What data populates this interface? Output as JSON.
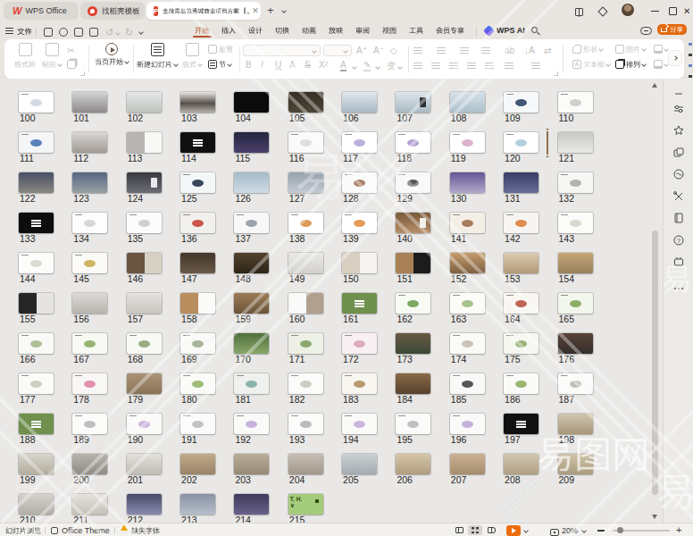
{
  "window": {
    "tabs": [
      {
        "label": "WPS Office",
        "icon": "wps-logo"
      },
      {
        "label": "找稻壳模板",
        "icon": "docer-logo"
      },
      {
        "label": "金茂青岛览秀城商业项目方案",
        "icon": "ppt-file-icon",
        "active": true
      }
    ],
    "new_tab": "+",
    "controls": [
      "split-view",
      "3d-cube",
      "avatar",
      "minimize",
      "maximize",
      "close"
    ]
  },
  "menubar": {
    "file_label": "文件",
    "quick_icons": [
      "save",
      "export-pdf",
      "print",
      "print-preview",
      "undo",
      "redo",
      "more"
    ],
    "items": [
      {
        "label": "开始",
        "active": true
      },
      {
        "label": "插入"
      },
      {
        "label": "设计"
      },
      {
        "label": "切换"
      },
      {
        "label": "动画"
      },
      {
        "label": "放映"
      },
      {
        "label": "审阅"
      },
      {
        "label": "视图"
      },
      {
        "label": "工具"
      },
      {
        "label": "会员专享"
      }
    ],
    "ai_label": "WPS AI",
    "share_label": "分享",
    "accent_color": "#b5532a",
    "share_color": "#e2690f"
  },
  "ribbon": {
    "format_painter": "格式刷",
    "paste": "粘贴",
    "play_current": "当页开始",
    "new_slide": "新建幻灯片",
    "layout": "版式",
    "reset": "重置",
    "section": "节",
    "font_toggles": [
      "B",
      "I",
      "U",
      "A",
      "S",
      "X²"
    ],
    "shapes": "形状",
    "picture": "图片",
    "textbox": "文本框",
    "arrange": "排列"
  },
  "sorter": {
    "slides": [
      {
        "n": "100",
        "t": "wh",
        "c": [
          "#ffffff"
        ],
        "a": "#ccd4de"
      },
      {
        "n": "101",
        "t": "ph",
        "c": [
          "#d2d1d3",
          "#8e898b"
        ]
      },
      {
        "n": "102",
        "t": "ph",
        "c": [
          "#e6e8e7",
          "#bcc2bd"
        ]
      },
      {
        "n": "103",
        "t": "phm",
        "c": [
          "#e9e7e3",
          "#57504c",
          "#b3afa9"
        ]
      },
      {
        "n": "104",
        "t": "bk",
        "c": [
          "#0b0b0b"
        ]
      },
      {
        "n": "105",
        "t": "ph",
        "c": [
          "#352f25",
          "#4d4737"
        ]
      },
      {
        "n": "106",
        "t": "ph",
        "c": [
          "#e2e8ec",
          "#a7b8c3"
        ]
      },
      {
        "n": "107",
        "t": "ph",
        "c": [
          "#dee6eb",
          "#a8b8c2"
        ],
        "a": "#2b2f34"
      },
      {
        "n": "108",
        "t": "ph",
        "c": [
          "#d7e2e9",
          "#abbfcb"
        ]
      },
      {
        "n": "109",
        "t": "wh",
        "c": [
          "#f6f8f9"
        ],
        "a": "#1e3a5e"
      },
      {
        "n": "110",
        "t": "wh",
        "c": [
          "#fbfbfa"
        ],
        "a": "#c7c7c4"
      },
      {
        "n": "111",
        "t": "wh",
        "c": [
          "#f3f5f7"
        ],
        "a": "#3f6cb0"
      },
      {
        "n": "112",
        "t": "ph",
        "c": [
          "#dad6d3",
          "#a09a95"
        ]
      },
      {
        "n": "113",
        "t": "spl",
        "c": [
          "#b7b4b1",
          "#f8f8f7"
        ]
      },
      {
        "n": "114",
        "t": "bk",
        "c": [
          "#101010"
        ],
        "i": 1
      },
      {
        "n": "115",
        "t": "ph",
        "c": [
          "#23263c",
          "#4b3f6d"
        ]
      },
      {
        "n": "116",
        "t": "wh",
        "c": [
          "#fafafa"
        ],
        "a": "#d8d8d8"
      },
      {
        "n": "117",
        "t": "wh",
        "c": [
          "#ffffff"
        ],
        "a": "#b2a1d5"
      },
      {
        "n": "118",
        "t": "wh",
        "c": [
          "#ffffff"
        ],
        "a": "#a78fcb"
      },
      {
        "n": "119",
        "t": "wh",
        "c": [
          "#ffffff"
        ],
        "a": "#d4a7c7"
      },
      {
        "n": "120",
        "t": "wh",
        "c": [
          "#ffffff"
        ],
        "a": "#a7c7d7"
      },
      {
        "n": "121",
        "t": "ph",
        "c": [
          "#c6c6c4",
          "#eaeae8"
        ]
      },
      {
        "n": "122",
        "t": "ph",
        "c": [
          "#475067",
          "#8c8780"
        ]
      },
      {
        "n": "123",
        "t": "ph",
        "c": [
          "#566681",
          "#99a0a4"
        ]
      },
      {
        "n": "124",
        "t": "ph",
        "c": [
          "#393940",
          "#6d6d75"
        ],
        "a": "#e8e8ed"
      },
      {
        "n": "125",
        "t": "wh",
        "c": [
          "#f4f7f8"
        ],
        "a": "#182840"
      },
      {
        "n": "126",
        "t": "ph",
        "c": [
          "#a5b9c8",
          "#cfdce5"
        ]
      },
      {
        "n": "127",
        "t": "ph",
        "c": [
          "#96a2ad",
          "#c3cbd3"
        ]
      },
      {
        "n": "128",
        "t": "wh",
        "c": [
          "#fafafa"
        ],
        "a": "#9f6950"
      },
      {
        "n": "129",
        "t": "wh",
        "c": [
          "#f8f8f8"
        ],
        "a": "#3a3a3a"
      },
      {
        "n": "130",
        "t": "ph",
        "c": [
          "#645593",
          "#b3a9cc"
        ]
      },
      {
        "n": "131",
        "t": "ph",
        "c": [
          "#373c65",
          "#696e99"
        ]
      },
      {
        "n": "132",
        "t": "wh",
        "c": [
          "#f6f6f5"
        ],
        "a": "#a7a7a3"
      },
      {
        "n": "133",
        "t": "bk",
        "c": [
          "#0d0d0d"
        ],
        "i": 1
      },
      {
        "n": "134",
        "t": "wh",
        "c": [
          "#fdfdfd"
        ],
        "a": "#cfcfcb"
      },
      {
        "n": "135",
        "t": "wh",
        "c": [
          "#fcfcfc"
        ],
        "a": "#c7c7c3"
      },
      {
        "n": "136",
        "t": "wh",
        "c": [
          "#f1f0ee"
        ],
        "a": "#c23a2e"
      },
      {
        "n": "137",
        "t": "wh",
        "c": [
          "#f8f8f8"
        ],
        "a": "#8995a1"
      },
      {
        "n": "138",
        "t": "wh",
        "c": [
          "#ffffff"
        ],
        "a": "#d78939"
      },
      {
        "n": "139",
        "t": "wh",
        "c": [
          "#ffffff"
        ],
        "a": "#df8939"
      },
      {
        "n": "140",
        "t": "ph",
        "c": [
          "#795a3a",
          "#b78f69"
        ],
        "a": "#f4f1e9"
      },
      {
        "n": "141",
        "t": "wh",
        "c": [
          "#f4efe6"
        ],
        "a": "#996944"
      },
      {
        "n": "142",
        "t": "wh",
        "c": [
          "#f7f5f1"
        ],
        "a": "#dc7930"
      },
      {
        "n": "143",
        "t": "wh",
        "c": [
          "#fbfbf9"
        ],
        "a": "#d4d1c7"
      },
      {
        "n": "144",
        "t": "wh",
        "c": [
          "#fcfcfb"
        ],
        "a": "#d7d4cb"
      },
      {
        "n": "145",
        "t": "wh",
        "c": [
          "#fbfaf7"
        ],
        "a": "#c7a749"
      },
      {
        "n": "146",
        "t": "spl",
        "c": [
          "#6a5543",
          "#d7d1c5"
        ]
      },
      {
        "n": "147",
        "t": "ph",
        "c": [
          "#42352a",
          "#6a5a48"
        ]
      },
      {
        "n": "148",
        "t": "ph",
        "c": [
          "#53422e",
          "#2e2518"
        ]
      },
      {
        "n": "149",
        "t": "ph",
        "c": [
          "#e9e8e5",
          "#d3d1cc"
        ]
      },
      {
        "n": "150",
        "t": "spl",
        "c": [
          "#d8cfc1",
          "#f5f4f1"
        ]
      },
      {
        "n": "151",
        "t": "spl",
        "c": [
          "#a78155",
          "#1c1c1c"
        ]
      },
      {
        "n": "152",
        "t": "ph",
        "c": [
          "#c49b6b",
          "#7d6041"
        ]
      },
      {
        "n": "153",
        "t": "ph",
        "c": [
          "#dbcbb1",
          "#b39977"
        ]
      },
      {
        "n": "154",
        "t": "ph",
        "c": [
          "#c8a777",
          "#987f5d"
        ]
      },
      {
        "n": "155",
        "t": "spl",
        "c": [
          "#262626",
          "#e5e4e1"
        ]
      },
      {
        "n": "156",
        "t": "ph",
        "c": [
          "#dcdad6",
          "#b7b3ad"
        ]
      },
      {
        "n": "157",
        "t": "ph",
        "c": [
          "#e5e3df",
          "#c8c5bf"
        ]
      },
      {
        "n": "158",
        "t": "spl",
        "c": [
          "#b88e5f",
          "#fafaf8"
        ]
      },
      {
        "n": "159",
        "t": "ph",
        "c": [
          "#9b7b56",
          "#6b543a"
        ]
      },
      {
        "n": "160",
        "t": "spl",
        "c": [
          "#f9f9f8",
          "#b0a08f"
        ]
      },
      {
        "n": "161",
        "t": "gr",
        "c": [
          "#70904e"
        ],
        "i": 1
      },
      {
        "n": "162",
        "t": "wh",
        "c": [
          "#f8faf4"
        ],
        "a": "#699a49"
      },
      {
        "n": "163",
        "t": "wh",
        "c": [
          "#fbfbf8"
        ],
        "a": "#99b779"
      },
      {
        "n": "164",
        "t": "wh",
        "c": [
          "#f8f6f1"
        ],
        "a": "#b74939"
      },
      {
        "n": "165",
        "t": "wh",
        "c": [
          "#f3f6ec"
        ],
        "a": "#79a051"
      },
      {
        "n": "166",
        "t": "wh",
        "c": [
          "#f9f9f6"
        ],
        "a": "#9fb785"
      },
      {
        "n": "167",
        "t": "wh",
        "c": [
          "#f7f9f3"
        ],
        "a": "#85a759"
      },
      {
        "n": "168",
        "t": "wh",
        "c": [
          "#f8f8f5"
        ],
        "a": "#89a069"
      },
      {
        "n": "169",
        "t": "wh",
        "c": [
          "#f9f9f7"
        ],
        "a": "#99aa89"
      },
      {
        "n": "170",
        "t": "ph",
        "c": [
          "#506f3e",
          "#88a768"
        ]
      },
      {
        "n": "171",
        "t": "wh",
        "c": [
          "#edf1e5"
        ],
        "a": "#799a59"
      },
      {
        "n": "172",
        "t": "wh",
        "c": [
          "#f8f0f2"
        ],
        "a": "#d79fb3"
      },
      {
        "n": "173",
        "t": "ph",
        "c": [
          "#695944",
          "#3b4937"
        ]
      },
      {
        "n": "174",
        "t": "wh",
        "c": [
          "#fafaf7"
        ],
        "a": "#bfbbaf"
      },
      {
        "n": "175",
        "t": "wh",
        "c": [
          "#f5f7f0"
        ],
        "a": "#89a761"
      },
      {
        "n": "176",
        "t": "ph",
        "c": [
          "#594337",
          "#332e2b"
        ]
      },
      {
        "n": "177",
        "t": "wh",
        "c": [
          "#fafaf8"
        ],
        "a": "#c7c3b7"
      },
      {
        "n": "178",
        "t": "wh",
        "c": [
          "#f9f7f6"
        ],
        "a": "#df7f9f"
      },
      {
        "n": "179",
        "t": "ph",
        "c": [
          "#aa9377",
          "#897357"
        ]
      },
      {
        "n": "180",
        "t": "wh",
        "c": [
          "#fafaf8"
        ],
        "a": "#8fb05f"
      },
      {
        "n": "181",
        "t": "wh",
        "c": [
          "#eef1ee"
        ],
        "a": "#79a79f"
      },
      {
        "n": "182",
        "t": "wh",
        "c": [
          "#fbfbfa"
        ],
        "a": "#c3c3bb"
      },
      {
        "n": "183",
        "t": "wh",
        "c": [
          "#f8f6f1"
        ],
        "a": "#af8959"
      },
      {
        "n": "184",
        "t": "ph",
        "c": [
          "#896947",
          "#58422e"
        ]
      },
      {
        "n": "185",
        "t": "wh",
        "c": [
          "#f9f9f7"
        ],
        "a": "#3a3a3a"
      },
      {
        "n": "186",
        "t": "wh",
        "c": [
          "#fafaf8"
        ],
        "a": "#87a957"
      },
      {
        "n": "187",
        "t": "wh",
        "c": [
          "#fafaf9"
        ],
        "a": "#b3b3ab"
      },
      {
        "n": "188",
        "t": "gr",
        "c": [
          "#70904e"
        ],
        "i": 1
      },
      {
        "n": "189",
        "t": "wh",
        "c": [
          "#fbfbf9"
        ],
        "a": "#b3b3b7"
      },
      {
        "n": "190",
        "t": "wh",
        "c": [
          "#fafaf9"
        ],
        "a": "#c1a7d9"
      },
      {
        "n": "191",
        "t": "wh",
        "c": [
          "#fbfbfb"
        ],
        "a": "#b7b7bb"
      },
      {
        "n": "192",
        "t": "wh",
        "c": [
          "#fafaf9"
        ],
        "a": "#bea5d7"
      },
      {
        "n": "193",
        "t": "wh",
        "c": [
          "#fbfbfa"
        ],
        "a": "#afafb3"
      },
      {
        "n": "194",
        "t": "wh",
        "c": [
          "#fafaf9"
        ],
        "a": "#c1a9d7"
      },
      {
        "n": "195",
        "t": "wh",
        "c": [
          "#fbfbf9"
        ],
        "a": "#b5b5b9"
      },
      {
        "n": "196",
        "t": "wh",
        "c": [
          "#fafaf9"
        ],
        "a": "#bba3d3"
      },
      {
        "n": "197",
        "t": "bk",
        "c": [
          "#111111"
        ],
        "i": 1
      },
      {
        "n": "198",
        "t": "ph",
        "c": [
          "#d1c6b1",
          "#a79777"
        ]
      },
      {
        "n": "199",
        "t": "ph",
        "c": [
          "#d8d5ce",
          "#b4ad9e"
        ]
      },
      {
        "n": "200",
        "t": "ph",
        "c": [
          "#b7b4ae",
          "#8f8b84"
        ]
      },
      {
        "n": "201",
        "t": "ph",
        "c": [
          "#e2e0db",
          "#c1bdb5"
        ]
      },
      {
        "n": "202",
        "t": "ph",
        "c": [
          "#c2aa8a",
          "#998367"
        ]
      },
      {
        "n": "203",
        "t": "ph",
        "c": [
          "#baad9a",
          "#968975"
        ]
      },
      {
        "n": "204",
        "t": "ph",
        "c": [
          "#c6beb3",
          "#a2998c"
        ]
      },
      {
        "n": "205",
        "t": "ph",
        "c": [
          "#cbd1d3",
          "#a4acb1"
        ]
      },
      {
        "n": "206",
        "t": "ph",
        "c": [
          "#d6c5a9",
          "#b09d7f"
        ]
      },
      {
        "n": "207",
        "t": "ph",
        "c": [
          "#cab292",
          "#a58c6c"
        ]
      },
      {
        "n": "208",
        "t": "ph",
        "c": [
          "#d3c6af",
          "#afa084"
        ]
      },
      {
        "n": "209",
        "t": "ph",
        "c": [
          "#d0c3a9",
          "#aa9b7e"
        ]
      },
      {
        "n": "210",
        "t": "ph",
        "c": [
          "#d5d2cc",
          "#b2aea6"
        ]
      },
      {
        "n": "211",
        "t": "ph",
        "c": [
          "#e5e2dc",
          "#c5c1b9"
        ]
      },
      {
        "n": "212",
        "t": "ph",
        "c": [
          "#494969",
          "#8b8baf"
        ]
      },
      {
        "n": "213",
        "t": "ph",
        "c": [
          "#8992a4",
          "#b7bfcb"
        ]
      },
      {
        "n": "214",
        "t": "ph",
        "c": [
          "#3f395b",
          "#69618b"
        ]
      },
      {
        "n": "215",
        "t": "tx",
        "c": [
          "#a5cb7d"
        ]
      }
    ],
    "slide_215_text": "T. H.",
    "slide_215_sub": "∨",
    "insertion_after_slide": "120"
  },
  "sidebar": {
    "icons": [
      "collapse-dash",
      "properties-sliders",
      "star",
      "shapes-stack",
      "docer-resource",
      "toolbox",
      "notebook",
      "help",
      "plugin",
      "more-dots"
    ]
  },
  "statusbar": {
    "view_mode": "幻灯片浏览",
    "theme": "Office Theme",
    "missing_fonts": "缺失字体",
    "zoom": "20%",
    "view_buttons": [
      "normal-view",
      "sorter-view",
      "reading-view"
    ],
    "active_view": "sorter-view",
    "play_color": "#ed6c0c",
    "warning_color": "#f0a202"
  },
  "watermark": {
    "site": "易图网",
    "domain": "yitu.cn"
  }
}
